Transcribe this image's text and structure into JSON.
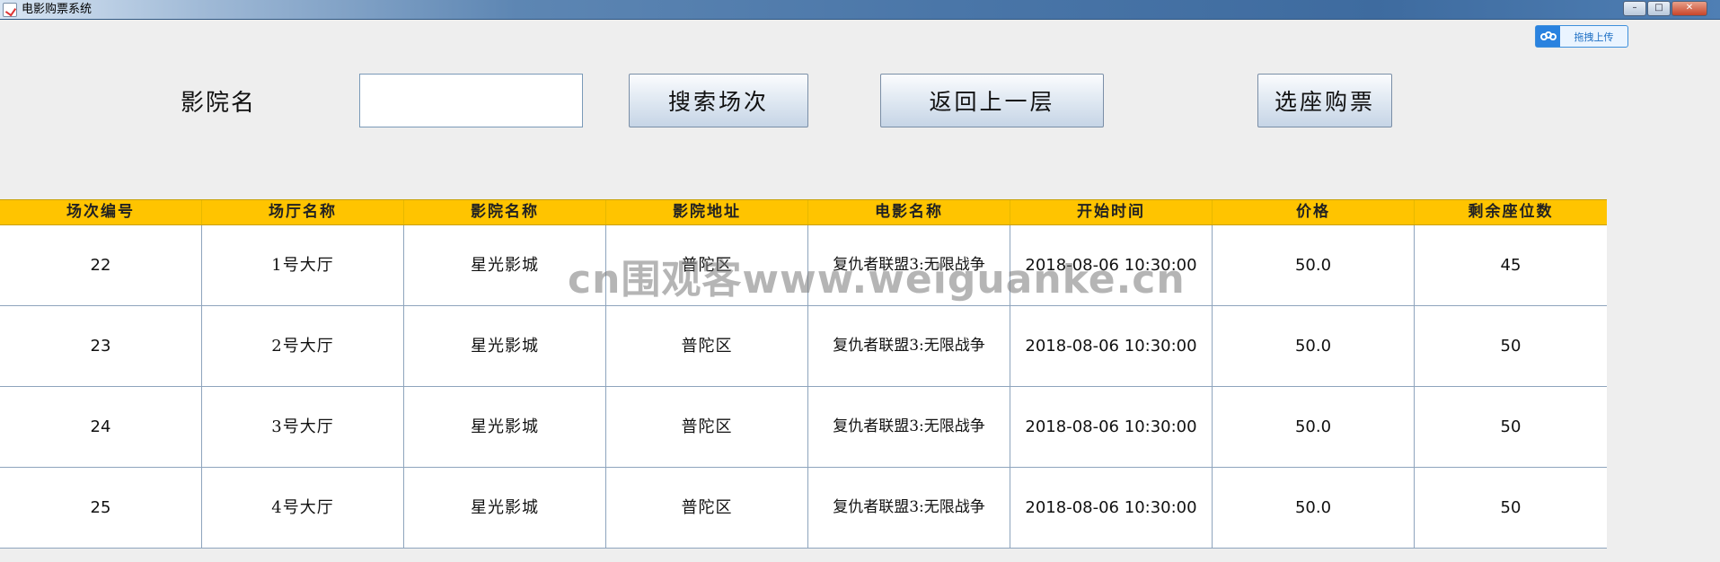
{
  "window": {
    "title": "电影购票系统",
    "controls": {
      "minimize": "–",
      "maximize": "□",
      "close": "✕"
    }
  },
  "upload_chip": {
    "label": "拖拽上传",
    "icon": "cloud-icon"
  },
  "search": {
    "label": "影院名",
    "input_value": "",
    "search_button": "搜索场次",
    "back_button": "返回上一层",
    "buy_button": "选座购票"
  },
  "table": {
    "columns": [
      "场次编号",
      "场厅名称",
      "影院名称",
      "影院地址",
      "电影名称",
      "开始时间",
      "价格",
      "剩余座位数"
    ],
    "rows": [
      [
        "22",
        "1号大厅",
        "星光影城",
        "普陀区",
        "复仇者联盟3:无限战争",
        "2018-08-06 10:30:00",
        "50.0",
        "45"
      ],
      [
        "23",
        "2号大厅",
        "星光影城",
        "普陀区",
        "复仇者联盟3:无限战争",
        "2018-08-06 10:30:00",
        "50.0",
        "50"
      ],
      [
        "24",
        "3号大厅",
        "星光影城",
        "普陀区",
        "复仇者联盟3:无限战争",
        "2018-08-06 10:30:00",
        "50.0",
        "50"
      ],
      [
        "25",
        "4号大厅",
        "星光影城",
        "普陀区",
        "复仇者联盟3:无限战争",
        "2018-08-06 10:30:00",
        "50.0",
        "50"
      ]
    ]
  },
  "watermark": "cn围观客www.weiguanke.cn",
  "colors": {
    "header_bg": "#ffc400",
    "grid": "#8ea4bd",
    "background": "#eeeeee"
  }
}
